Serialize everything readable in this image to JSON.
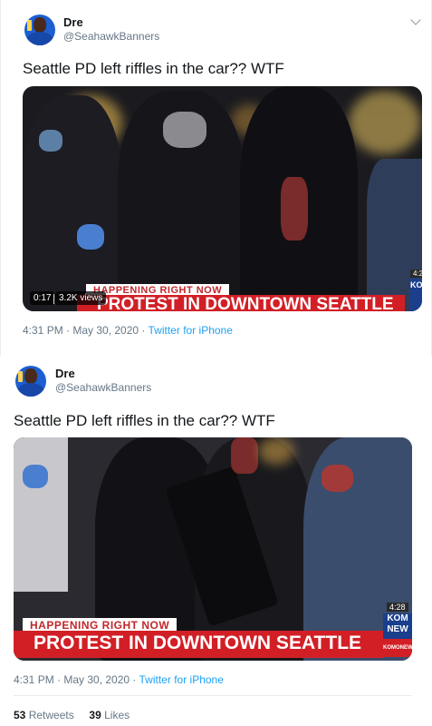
{
  "tweets": [
    {
      "name": "Dre",
      "handle": "@SeahawkBanners",
      "text": "Seattle PD left riffles in the car?? WTF",
      "video": {
        "time": "0:17",
        "views": "3.2K views",
        "banner_top": "HAPPENING RIGHT NOW",
        "banner_main": "PROTEST IN DOWNTOWN SEATTLE",
        "station": "KO",
        "clock": "4:2"
      },
      "timestamp": "4:31 PM · May 30, 2020 · ",
      "source": "Twitter for iPhone"
    },
    {
      "name": "Dre",
      "handle": "@SeahawkBanners",
      "text": "Seattle PD left riffles in the car?? WTF",
      "video": {
        "banner_top": "HAPPENING RIGHT NOW",
        "banner_main": "PROTEST IN DOWNTOWN SEATTLE",
        "station": "KOM NEW",
        "clock": "4:28",
        "station_sub": "KOMONEWS"
      },
      "timestamp": "4:31 PM · May 30, 2020 · ",
      "source": "Twitter for iPhone",
      "retweets": "53",
      "retweets_label": "Retweets",
      "likes": "39",
      "likes_label": "Likes"
    }
  ],
  "icons": {
    "more": "chevron-down-icon",
    "avatar": "avatar"
  },
  "colors": {
    "link": "#1da1f2",
    "muted": "#657786",
    "banner_red": "#d21f26"
  }
}
